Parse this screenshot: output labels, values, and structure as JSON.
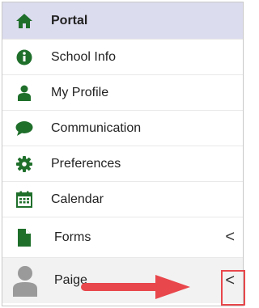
{
  "menu": {
    "items": [
      {
        "label": "Portal",
        "icon": "home-icon"
      },
      {
        "label": "School Info",
        "icon": "info-circle-icon"
      },
      {
        "label": "My Profile",
        "icon": "user-icon"
      },
      {
        "label": "Communication",
        "icon": "chat-bubble-icon"
      },
      {
        "label": "Preferences",
        "icon": "gear-icon"
      },
      {
        "label": "Calendar",
        "icon": "calendar-icon"
      },
      {
        "label": "Forms",
        "icon": "document-icon",
        "chevron": "<"
      }
    ],
    "user": {
      "name": "Paige",
      "chevron": "<",
      "icon": "avatar-icon"
    }
  },
  "colors": {
    "icon_green": "#1f6f2b",
    "active_bg": "#dcdcef",
    "highlight_red": "#e8474c"
  }
}
